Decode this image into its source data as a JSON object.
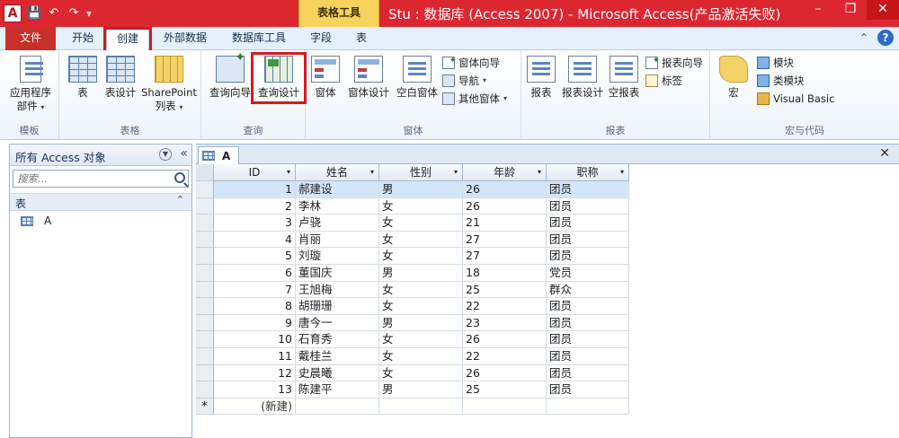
{
  "app": {
    "icon_letter": "A",
    "title": "Stu : 数据库 (Access 2007) - Microsoft Access(产品激活失败)",
    "context_tab": "表格工具"
  },
  "qat": {
    "save": "💾",
    "undo": "↶",
    "redo": "↷",
    "customize": "▾"
  },
  "window": {
    "minimize": "–",
    "maximize": "❐",
    "close": "✕"
  },
  "tabs": {
    "file": "文件",
    "home": "开始",
    "create": "创建",
    "external": "外部数据",
    "dbtools": "数据库工具",
    "fields": "字段",
    "table": "表"
  },
  "ribbon": {
    "templates": {
      "label": "模板",
      "app_parts": "应用程序",
      "app_parts2": "部件"
    },
    "tables": {
      "label": "表格",
      "table": "表",
      "table_design": "表设计",
      "sharepoint": "SharePoint",
      "sharepoint2": "列表"
    },
    "queries": {
      "label": "查询",
      "wizard": "查询向导",
      "design": "查询设计"
    },
    "forms": {
      "label": "窗体",
      "form": "窗体",
      "form_design": "窗体设计",
      "blank_form": "空白窗体",
      "form_wizard": "窗体向导",
      "navigation": "导航",
      "more_forms": "其他窗体"
    },
    "reports": {
      "label": "报表",
      "report": "报表",
      "report_design": "报表设计",
      "blank_report": "空报表",
      "report_wizard": "报表向导",
      "labels": "标签"
    },
    "macros": {
      "label": "宏与代码",
      "macro": "宏",
      "module": "模块",
      "class_module": "类模块",
      "vb": "Visual Basic"
    }
  },
  "nav": {
    "title": "所有 Access 对象",
    "search_placeholder": "搜索...",
    "group": "表",
    "items": [
      "A"
    ]
  },
  "doc": {
    "tab_name": "A"
  },
  "table": {
    "columns": [
      "ID",
      "姓名",
      "性别",
      "年龄",
      "职称"
    ],
    "rows": [
      [
        "1",
        "郝建设",
        "男",
        "26",
        "团员"
      ],
      [
        "2",
        "李林",
        "女",
        "26",
        "团员"
      ],
      [
        "3",
        "卢骁",
        "女",
        "21",
        "团员"
      ],
      [
        "4",
        "肖丽",
        "女",
        "27",
        "团员"
      ],
      [
        "5",
        "刘璇",
        "女",
        "27",
        "团员"
      ],
      [
        "6",
        "董国庆",
        "男",
        "18",
        "党员"
      ],
      [
        "7",
        "王旭梅",
        "女",
        "25",
        "群众"
      ],
      [
        "8",
        "胡珊珊",
        "女",
        "22",
        "团员"
      ],
      [
        "9",
        "唐今一",
        "男",
        "23",
        "团员"
      ],
      [
        "10",
        "石育秀",
        "女",
        "26",
        "团员"
      ],
      [
        "11",
        "戴桂兰",
        "女",
        "22",
        "团员"
      ],
      [
        "12",
        "史晨曦",
        "女",
        "26",
        "团员"
      ],
      [
        "13",
        "陈建平",
        "男",
        "25",
        "团员"
      ]
    ],
    "new_row_marker": "*",
    "new_row_label": "(新建)"
  }
}
